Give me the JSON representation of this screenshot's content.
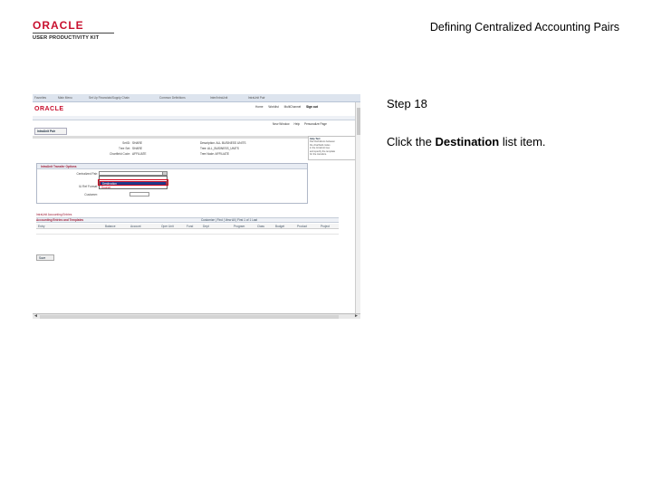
{
  "header": {
    "logo_top": "ORACLE",
    "logo_sub": "USER PRODUCTIVITY KIT",
    "title": "Defining Centralized Accounting Pairs"
  },
  "step": {
    "label": "Step 18",
    "instruction_before": "Click the ",
    "instruction_target": "Destination",
    "instruction_after": " list item."
  },
  "screenshot": {
    "nav_items": [
      "Favorites",
      "Main Menu",
      "Set Up Financials/Supply Chain",
      "Common Definitions",
      "Inter/IntraUnit",
      "IntraUnit Pair"
    ],
    "logo": "ORACLE",
    "top_links": [
      "Home",
      "Worklist",
      "MultiChannel",
      "Sign out"
    ],
    "page_links": [
      "New Window",
      "Help",
      "Personalize Page"
    ],
    "tab": "IntraUnit Pair",
    "fields": [
      {
        "label": "SetID:",
        "value": "SHARE"
      },
      {
        "label": "Tree Set:",
        "value": "SHARE"
      },
      {
        "label": "Chartfield Code:",
        "value": "AFFILIATE"
      }
    ],
    "fields_right": [
      "Description: ALL BUSINESS UNITS",
      "Tree: ALL_BUSINESS_UNITS",
      "Tree Node: AFFILIATE"
    ],
    "help_lines": [
      "Help Text",
      "Pair Definitions between",
      "the chartfield codes",
      "in the IntraUnit tree",
      "and specify the template",
      "for the transfers."
    ],
    "panel_title": "IntraUnit Transfer Options",
    "panel_fields": [
      "Centralized Pair:",
      "IU Ref Format:",
      "Customer:"
    ],
    "dropdown_items": [
      "",
      "Destination",
      "Source"
    ],
    "grid_title": "IntraUnit Accounting Entries",
    "grid_subtitle": "Accounting Entries and Templates",
    "grid_nav": "Customize | Find | View All |   First  1 of 1  Last",
    "grid_cols": [
      "Entry",
      "Balance",
      "Account",
      "Oper Unit",
      "Fund",
      "Dept",
      "Program",
      "Class",
      "Budget",
      "Product",
      "Project"
    ],
    "save_label": "Save"
  }
}
